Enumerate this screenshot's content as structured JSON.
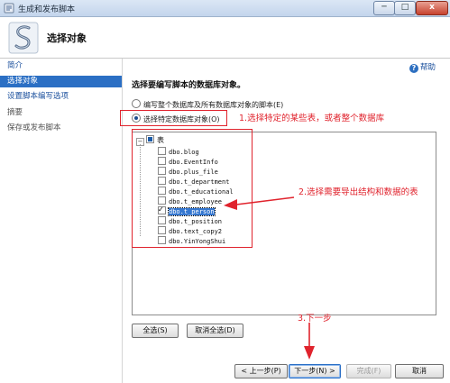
{
  "window": {
    "title": "生成和发布脚本",
    "min_glyph": "─",
    "max_glyph": "□",
    "close_glyph": "x"
  },
  "header": {
    "page_title": "选择对象",
    "logo_icon": "script-scroll-icon"
  },
  "sidebar": {
    "items": [
      {
        "label": "简介",
        "state": "link"
      },
      {
        "label": "选择对象",
        "state": "selected"
      },
      {
        "label": "设置脚本编写选项",
        "state": "link"
      },
      {
        "label": "摘要",
        "state": "disabled"
      },
      {
        "label": "保存或发布脚本",
        "state": "disabled"
      }
    ]
  },
  "main": {
    "help_label": "帮助",
    "heading": "选择要编写脚本的数据库对象。",
    "radio_all": "编写整个数据库及所有数据库对象的脚本(E)",
    "radio_specific": "选择特定数据库对象(O)",
    "tree": {
      "root_label": "表",
      "items": [
        {
          "label": "dbo.blog",
          "checked": false
        },
        {
          "label": "dbo.EventInfo",
          "checked": false
        },
        {
          "label": "dbo.plus_file",
          "checked": false
        },
        {
          "label": "dbo.t_department",
          "checked": false
        },
        {
          "label": "dbo.t_educational",
          "checked": false
        },
        {
          "label": "dbo.t_employee",
          "checked": false
        },
        {
          "label": "dbo.t_person",
          "checked": true
        },
        {
          "label": "dbo.t_position",
          "checked": false
        },
        {
          "label": "dbo.text_copy2",
          "checked": false
        },
        {
          "label": "dbo.YinYongShui",
          "checked": false
        }
      ]
    },
    "select_all": "全选(S)",
    "deselect_all": "取消全选(D)"
  },
  "footer": {
    "prev": "< 上一步(P)",
    "next": "下一步(N) >",
    "finish": "完成(F)",
    "cancel": "取消"
  },
  "annotations": {
    "note1": "1.选择特定的某些表，或者整个数据库",
    "note2": "2.选择需要导出结构和数据的表",
    "note3": "3.下一步",
    "color": "#e0232d"
  }
}
